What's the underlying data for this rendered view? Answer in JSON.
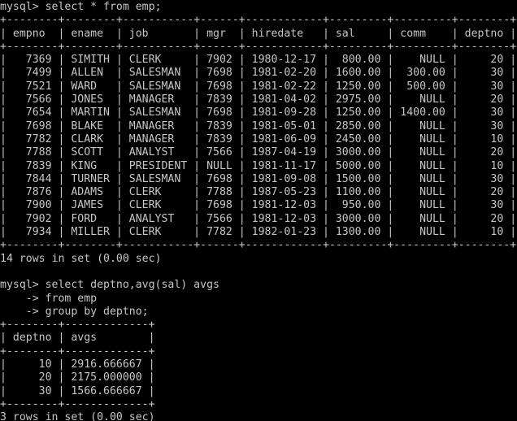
{
  "terminal": {
    "prompt": "mysql>",
    "continuation_prompt": "->",
    "foreground_color": "#c6c6c6",
    "background_color": "#000000"
  },
  "session": {
    "queries": [
      {
        "name": "select-all-emp",
        "prompt_line": "mysql> select * from emp;",
        "sql": "select * from emp;",
        "status": "14 rows in set (0.00 sec)"
      },
      {
        "name": "group-by-deptno-avg",
        "prompt_line": "mysql> select deptno,avg(sal) avgs",
        "continuation_lines": [
          "    -> from emp",
          "    -> group by deptno;"
        ],
        "sql": "select deptno,avg(sal) avgs from emp group by deptno;",
        "status": "3 rows in set (0.00 sec)"
      }
    ]
  },
  "table_emp": {
    "name": "emp-result-table",
    "border_top": "+--------+--------+-----------+------+------------+---------+---------+--------+",
    "border_mid": "+--------+--------+-----------+------+------------+---------+---------+--------+",
    "border_bottom": "+--------+--------+-----------+------+------------+---------+---------+--------+",
    "header_line": "| empno  | ename  | job       | mgr  | hiredate   | sal     | comm    | deptno |",
    "columns": [
      "empno",
      "ename",
      "job",
      "mgr",
      "hiredate",
      "sal",
      "comm",
      "deptno"
    ],
    "rows": [
      {
        "empno": "7369",
        "ename": "SIMITH",
        "job": "CLERK",
        "mgr": "7902",
        "hiredate": "1980-12-17",
        "sal": "800.00",
        "comm": "NULL",
        "deptno": "20"
      },
      {
        "empno": "7499",
        "ename": "ALLEN",
        "job": "SALESMAN",
        "mgr": "7698",
        "hiredate": "1981-02-20",
        "sal": "1600.00",
        "comm": "300.00",
        "deptno": "30"
      },
      {
        "empno": "7521",
        "ename": "WARD",
        "job": "SALESMAN",
        "mgr": "7698",
        "hiredate": "1981-02-22",
        "sal": "1250.00",
        "comm": "500.00",
        "deptno": "30"
      },
      {
        "empno": "7566",
        "ename": "JONES",
        "job": "MANAGER",
        "mgr": "7839",
        "hiredate": "1981-04-02",
        "sal": "2975.00",
        "comm": "NULL",
        "deptno": "20"
      },
      {
        "empno": "7654",
        "ename": "MARTIN",
        "job": "SALESMAN",
        "mgr": "7698",
        "hiredate": "1981-09-28",
        "sal": "1250.00",
        "comm": "1400.00",
        "deptno": "30"
      },
      {
        "empno": "7698",
        "ename": "BLAKE",
        "job": "MANAGER",
        "mgr": "7839",
        "hiredate": "1981-05-01",
        "sal": "2850.00",
        "comm": "NULL",
        "deptno": "30"
      },
      {
        "empno": "7782",
        "ename": "CLARK",
        "job": "MANAGER",
        "mgr": "7839",
        "hiredate": "1981-06-09",
        "sal": "2450.00",
        "comm": "NULL",
        "deptno": "10"
      },
      {
        "empno": "7788",
        "ename": "SCOTT",
        "job": "ANALYST",
        "mgr": "7566",
        "hiredate": "1987-04-19",
        "sal": "3000.00",
        "comm": "NULL",
        "deptno": "20"
      },
      {
        "empno": "7839",
        "ename": "KING",
        "job": "PRESIDENT",
        "mgr": "NULL",
        "hiredate": "1981-11-17",
        "sal": "5000.00",
        "comm": "NULL",
        "deptno": "10"
      },
      {
        "empno": "7844",
        "ename": "TURNER",
        "job": "SALESMAN",
        "mgr": "7698",
        "hiredate": "1981-09-08",
        "sal": "1500.00",
        "comm": "NULL",
        "deptno": "30"
      },
      {
        "empno": "7876",
        "ename": "ADAMS",
        "job": "CLERK",
        "mgr": "7788",
        "hiredate": "1987-05-23",
        "sal": "1100.00",
        "comm": "NULL",
        "deptno": "20"
      },
      {
        "empno": "7900",
        "ename": "JAMES",
        "job": "CLERK",
        "mgr": "7698",
        "hiredate": "1981-12-03",
        "sal": "950.00",
        "comm": "NULL",
        "deptno": "30"
      },
      {
        "empno": "7902",
        "ename": "FORD",
        "job": "ANALYST",
        "mgr": "7566",
        "hiredate": "1981-12-03",
        "sal": "3000.00",
        "comm": "NULL",
        "deptno": "20"
      },
      {
        "empno": "7934",
        "ename": "MILLER",
        "job": "CLERK",
        "mgr": "7782",
        "hiredate": "1982-01-23",
        "sal": "1300.00",
        "comm": "NULL",
        "deptno": "10"
      }
    ],
    "row_lines": [
      "|   7369 | SIMITH | CLERK     | 7902 | 1980-12-17 |  800.00 |    NULL |     20 |",
      "|   7499 | ALLEN  | SALESMAN  | 7698 | 1981-02-20 | 1600.00 |  300.00 |     30 |",
      "|   7521 | WARD   | SALESMAN  | 7698 | 1981-02-22 | 1250.00 |  500.00 |     30 |",
      "|   7566 | JONES  | MANAGER   | 7839 | 1981-04-02 | 2975.00 |    NULL |     20 |",
      "|   7654 | MARTIN | SALESMAN  | 7698 | 1981-09-28 | 1250.00 | 1400.00 |     30 |",
      "|   7698 | BLAKE  | MANAGER   | 7839 | 1981-05-01 | 2850.00 |    NULL |     30 |",
      "|   7782 | CLARK  | MANAGER   | 7839 | 1981-06-09 | 2450.00 |    NULL |     10 |",
      "|   7788 | SCOTT  | ANALYST   | 7566 | 1987-04-19 | 3000.00 |    NULL |     20 |",
      "|   7839 | KING   | PRESIDENT | NULL | 1981-11-17 | 5000.00 |    NULL |     10 |",
      "|   7844 | TURNER | SALESMAN  | 7698 | 1981-09-08 | 1500.00 |    NULL |     30 |",
      "|   7876 | ADAMS  | CLERK     | 7788 | 1987-05-23 | 1100.00 |    NULL |     20 |",
      "|   7900 | JAMES  | CLERK     | 7698 | 1981-12-03 |  950.00 |    NULL |     30 |",
      "|   7902 | FORD   | ANALYST   | 7566 | 1981-12-03 | 3000.00 |    NULL |     20 |",
      "|   7934 | MILLER | CLERK     | 7782 | 1982-01-23 | 1300.00 |    NULL |     10 |"
    ]
  },
  "table_avgs": {
    "name": "avgs-result-table",
    "border_top": "+--------+-------------+",
    "border_mid": "+--------+-------------+",
    "border_bottom": "+--------+-------------+",
    "header_line": "| deptno | avgs        |",
    "columns": [
      "deptno",
      "avgs"
    ],
    "rows": [
      {
        "deptno": "10",
        "avgs": "2916.666667"
      },
      {
        "deptno": "20",
        "avgs": "2175.000000"
      },
      {
        "deptno": "30",
        "avgs": "1566.666667"
      }
    ],
    "row_lines": [
      "|     10 | 2916.666667 |",
      "|     20 | 2175.000000 |",
      "|     30 | 1566.666667 |"
    ]
  },
  "screen_lines": [
    "mysql> select * from emp;",
    "+--------+--------+-----------+------+------------+---------+---------+--------+",
    "| empno  | ename  | job       | mgr  | hiredate   | sal     | comm    | deptno |",
    "+--------+--------+-----------+------+------------+---------+---------+--------+",
    "|   7369 | SIMITH | CLERK     | 7902 | 1980-12-17 |  800.00 |    NULL |     20 |",
    "|   7499 | ALLEN  | SALESMAN  | 7698 | 1981-02-20 | 1600.00 |  300.00 |     30 |",
    "|   7521 | WARD   | SALESMAN  | 7698 | 1981-02-22 | 1250.00 |  500.00 |     30 |",
    "|   7566 | JONES  | MANAGER   | 7839 | 1981-04-02 | 2975.00 |    NULL |     20 |",
    "|   7654 | MARTIN | SALESMAN  | 7698 | 1981-09-28 | 1250.00 | 1400.00 |     30 |",
    "|   7698 | BLAKE  | MANAGER   | 7839 | 1981-05-01 | 2850.00 |    NULL |     30 |",
    "|   7782 | CLARK  | MANAGER   | 7839 | 1981-06-09 | 2450.00 |    NULL |     10 |",
    "|   7788 | SCOTT  | ANALYST   | 7566 | 1987-04-19 | 3000.00 |    NULL |     20 |",
    "|   7839 | KING   | PRESIDENT | NULL | 1981-11-17 | 5000.00 |    NULL |     10 |",
    "|   7844 | TURNER | SALESMAN  | 7698 | 1981-09-08 | 1500.00 |    NULL |     30 |",
    "|   7876 | ADAMS  | CLERK     | 7788 | 1987-05-23 | 1100.00 |    NULL |     20 |",
    "|   7900 | JAMES  | CLERK     | 7698 | 1981-12-03 |  950.00 |    NULL |     30 |",
    "|   7902 | FORD   | ANALYST   | 7566 | 1981-12-03 | 3000.00 |    NULL |     20 |",
    "|   7934 | MILLER | CLERK     | 7782 | 1982-01-23 | 1300.00 |    NULL |     10 |",
    "+--------+--------+-----------+------+------------+---------+---------+--------+",
    "14 rows in set (0.00 sec)",
    "",
    "mysql> select deptno,avg(sal) avgs",
    "    -> from emp",
    "    -> group by deptno;",
    "+--------+-------------+",
    "| deptno | avgs        |",
    "+--------+-------------+",
    "|     10 | 2916.666667 |",
    "|     20 | 2175.000000 |",
    "|     30 | 1566.666667 |",
    "+--------+-------------+",
    "3 rows in set (0.00 sec)"
  ]
}
